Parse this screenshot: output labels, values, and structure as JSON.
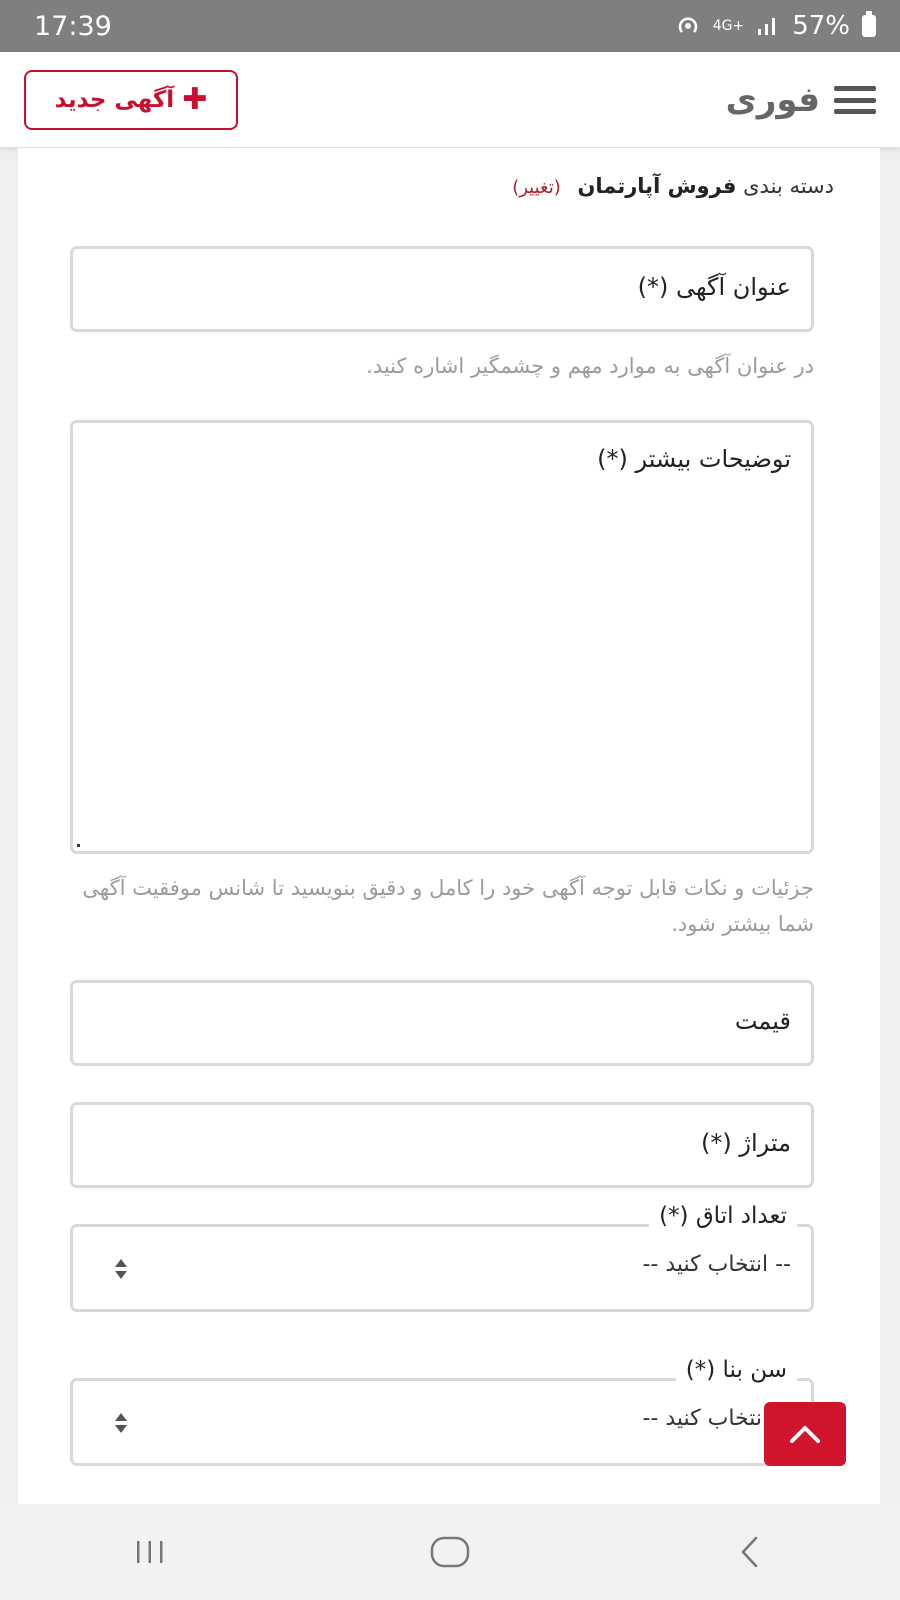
{
  "status_bar": {
    "time": "17:39",
    "network": "4G+",
    "battery": "57%"
  },
  "header": {
    "new_ad_label": "آگهی جدید",
    "brand_title": "فوری"
  },
  "form": {
    "category_prefix": "دسته بندی",
    "category_value": "فروش آپارتمان",
    "category_change": "(تغییر)",
    "title_label": "عنوان آگهی (*)",
    "title_help": "در عنوان آگهی به موارد مهم و چشمگیر اشاره کنید.",
    "description_label": "توضیحات بیشتر (*)",
    "description_help": "جزئیات و نکات قابل توجه آگهی خود را کامل و دقیق بنویسید تا شانس موفقیت آگهی شما بیشتر شود.",
    "price_label": "قیمت",
    "area_label": "متراژ (*)",
    "rooms_label": "تعداد اتاق (*)",
    "rooms_value": "-- انتخاب کنید --",
    "age_label": "سن بنا (*)",
    "age_value": "-- انتخاب کنید --"
  },
  "colors": {
    "accent": "#c8102e",
    "status_bar": "#7f7f7f",
    "help_text": "#9b9b9b"
  },
  "icons": {
    "menu": "hamburger-icon",
    "plus": "plus-icon",
    "sort": "sort-arrows-icon",
    "scroll_top": "chevron-up-icon",
    "nav_recents": "recents-icon",
    "nav_home": "home-icon",
    "nav_back": "back-icon"
  }
}
